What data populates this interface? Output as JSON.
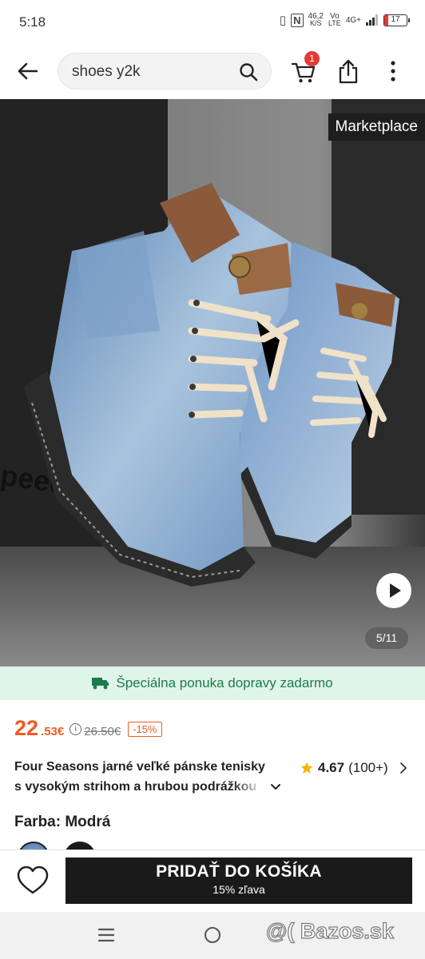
{
  "status_bar": {
    "time": "5:18",
    "net_speed_value": "46,2",
    "net_speed_unit": "K/S",
    "volte_top": "Vo",
    "volte_bottom": "LTE",
    "network": "4G+",
    "battery": "17"
  },
  "top_bar": {
    "search_query": "shoes y2k",
    "cart_badge": "1"
  },
  "gallery": {
    "tag": "Marketplace",
    "counter": "5/11",
    "image_text": "peed of"
  },
  "shipping": {
    "text": "Špeciálna ponuka dopravy zadarmo",
    "color": "#1d7a4a"
  },
  "price": {
    "integer": "22",
    "decimal": ".53€",
    "original": "26.50€",
    "discount": "-15%",
    "accent_color": "#f15a24"
  },
  "product": {
    "title_line1": "Four Seasons jarné veľké pánske tenisky",
    "title_line2": "s vysokým strihom a hrubou podrážkou",
    "rating": "4.67",
    "rating_count": "(100+)"
  },
  "color": {
    "label": "Farba: Modrá"
  },
  "action": {
    "add_to_cart": "PRIDAŤ DO KOŠÍKA",
    "add_to_cart_sub": "15% zľava"
  },
  "watermark": "@( Bazos.sk"
}
